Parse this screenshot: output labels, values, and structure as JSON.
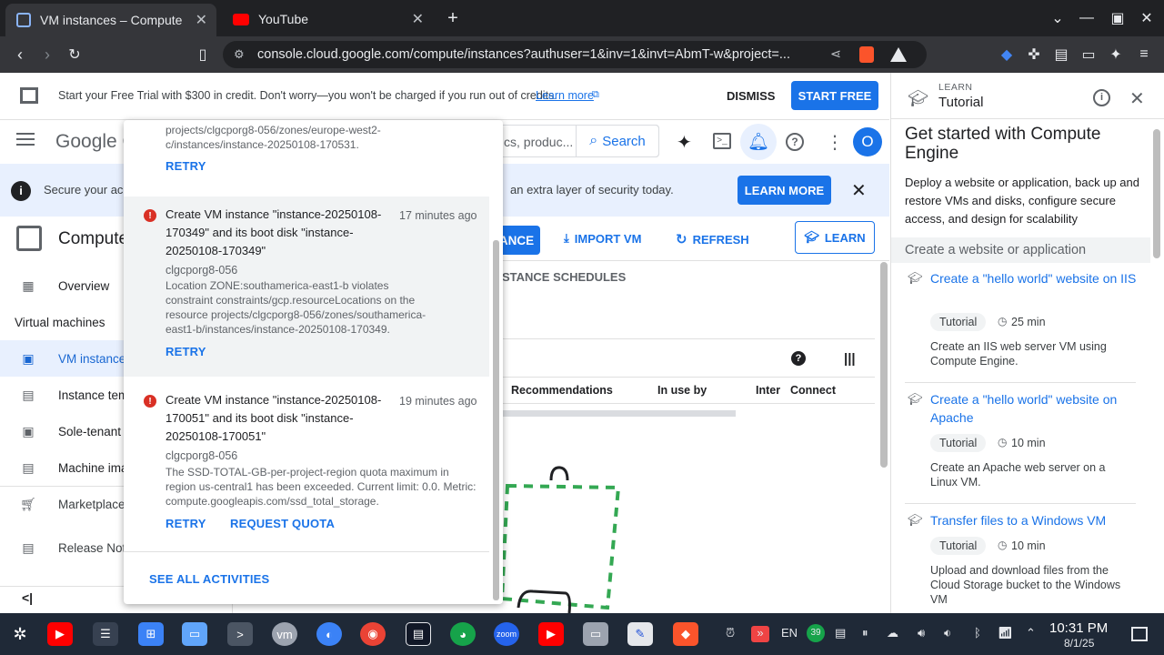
{
  "browser": {
    "tabs": [
      {
        "title": "VM instances – Compute En",
        "active": true
      },
      {
        "title": "YouTube",
        "active": false
      }
    ],
    "url": "console.cloud.google.com/compute/instances?authuser=1&inv=1&invt=AbmT-w&project=..."
  },
  "promo": {
    "text": "Start your Free Trial with $300 in credit. Don't worry—you won't be charged if you run out of credits.",
    "learn_more": "Learn more",
    "dismiss": "DISMISS",
    "start_free": "START FREE"
  },
  "header": {
    "logo": "Google C",
    "search_placeholder": "cs, produc...",
    "search_label": "Search",
    "avatar_letter": "O"
  },
  "banner": {
    "text_left": "Secure your ac",
    "text_right": "an extra layer of security today.",
    "learn_more": "LEARN MORE"
  },
  "sidebar": {
    "product": "Compute",
    "items": [
      {
        "label": "Overview"
      },
      {
        "label": "Virtual machines"
      },
      {
        "label": "VM instance"
      },
      {
        "label": "Instance tem"
      },
      {
        "label": "Sole-tenant n"
      },
      {
        "label": "Machine ima"
      },
      {
        "label": "Marketplace"
      },
      {
        "label": "Release Note"
      }
    ]
  },
  "main": {
    "create_btn": "ANCE",
    "import_vm": "IMPORT VM",
    "refresh": "REFRESH",
    "learn": "LEARN",
    "tab_schedules": "STANCE SCHEDULES",
    "columns": [
      "Recommendations",
      "In use by",
      "Inter",
      "Connect"
    ]
  },
  "notifications": {
    "partial_top": {
      "message": "projects/clgcporg8-056/zones/europe-west2-c/instances/instance-20250108-170531.",
      "retry": "RETRY"
    },
    "items": [
      {
        "title": "Create VM instance \"instance-20250108-170349\" and its boot disk \"instance-20250108-170349\"",
        "time": "17 minutes ago",
        "project": "clgcporg8-056",
        "message": "Location ZONE:southamerica-east1-b violates constraint constraints/gcp.resourceLocations on the resource projects/clgcporg8-056/zones/southamerica-east1-b/instances/instance-20250108-170349.",
        "actions": [
          "RETRY"
        ]
      },
      {
        "title": "Create VM instance \"instance-20250108-170051\" and its boot disk \"instance-20250108-170051\"",
        "time": "19 minutes ago",
        "project": "clgcporg8-056",
        "message": "The SSD-TOTAL-GB-per-project-region quota maximum in region us-central1 has been exceeded. Current limit: 0.0. Metric: compute.googleapis.com/ssd_total_storage.",
        "actions": [
          "RETRY",
          "REQUEST QUOTA"
        ]
      }
    ],
    "see_all": "SEE ALL ACTIVITIES"
  },
  "learn_panel": {
    "eyebrow": "LEARN",
    "title": "Tutorial",
    "heading": "Get started with Compute Engine",
    "intro": "Deploy a website or application, back up and restore VMs and disks, configure secure access, and design for scalability",
    "section": "Create a website or application",
    "tutorials": [
      {
        "title": "Create a \"hello world\" website on IIS",
        "chip": "Tutorial",
        "duration": "25 min",
        "desc": "Create an IIS web server VM using Compute Engine."
      },
      {
        "title": "Create a \"hello world\" website on Apache",
        "chip": "Tutorial",
        "duration": "10 min",
        "desc": "Create an Apache web server on a Linux VM."
      },
      {
        "title": "Transfer files to a Windows VM",
        "chip": "Tutorial",
        "duration": "10 min",
        "desc": "Upload and download files from the Cloud Storage bucket to the Windows VM"
      }
    ]
  },
  "taskbar": {
    "lang": "EN",
    "badge": "39",
    "time": "10:31 PM",
    "date": "8/1/25"
  }
}
